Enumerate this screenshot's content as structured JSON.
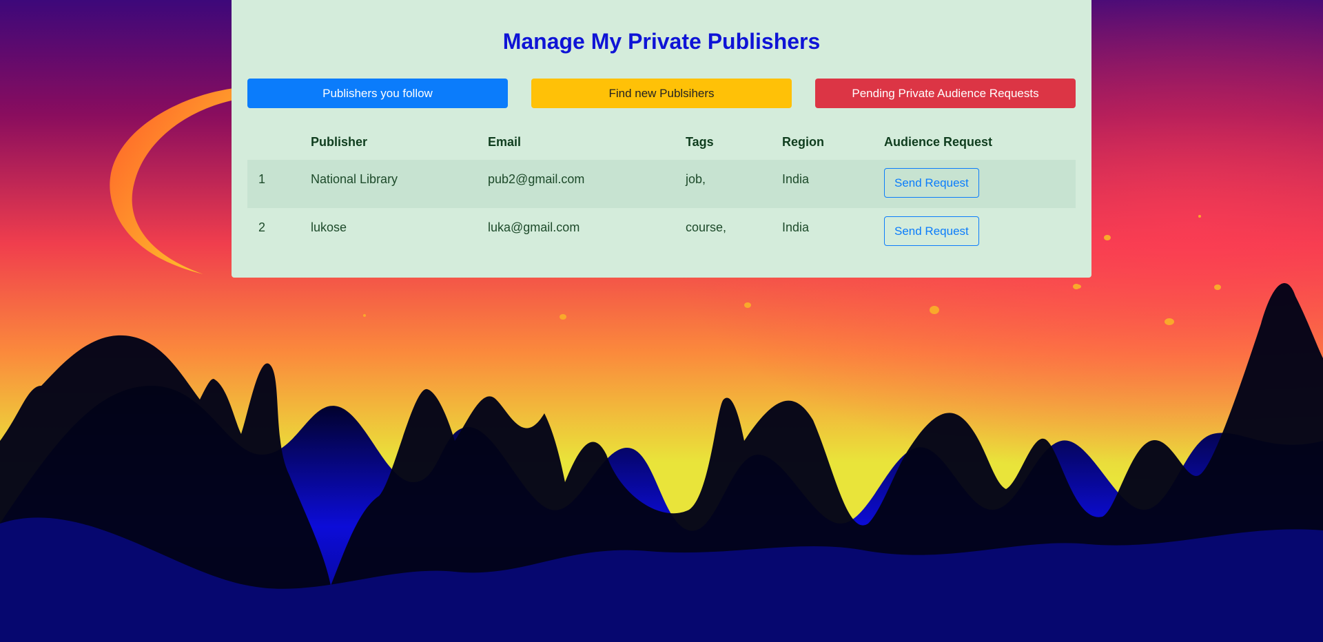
{
  "page": {
    "title": "Manage My Private Publishers"
  },
  "nav": {
    "follow_label": "Publishers you follow",
    "find_label": "Find new Publsihers",
    "pending_label": "Pending Private Audience Requests"
  },
  "table": {
    "headers": {
      "index": "",
      "publisher": "Publisher",
      "email": "Email",
      "tags": "Tags",
      "region": "Region",
      "audience": "Audience Request"
    },
    "rows": [
      {
        "index": "1",
        "publisher": "National Library",
        "email": "pub2@gmail.com",
        "tags": "job,",
        "region": "India",
        "action": "Send Request"
      },
      {
        "index": "2",
        "publisher": "lukose",
        "email": "luka@gmail.com",
        "tags": "course,",
        "region": "India",
        "action": "Send Request"
      }
    ]
  },
  "colors": {
    "card_bg": "#d4ecdb",
    "title": "#0f14d6",
    "primary": "#0b7cfb",
    "warning": "#ffc107",
    "danger": "#dc3545"
  },
  "background": {
    "scene": "sunset-mountains-moon"
  }
}
